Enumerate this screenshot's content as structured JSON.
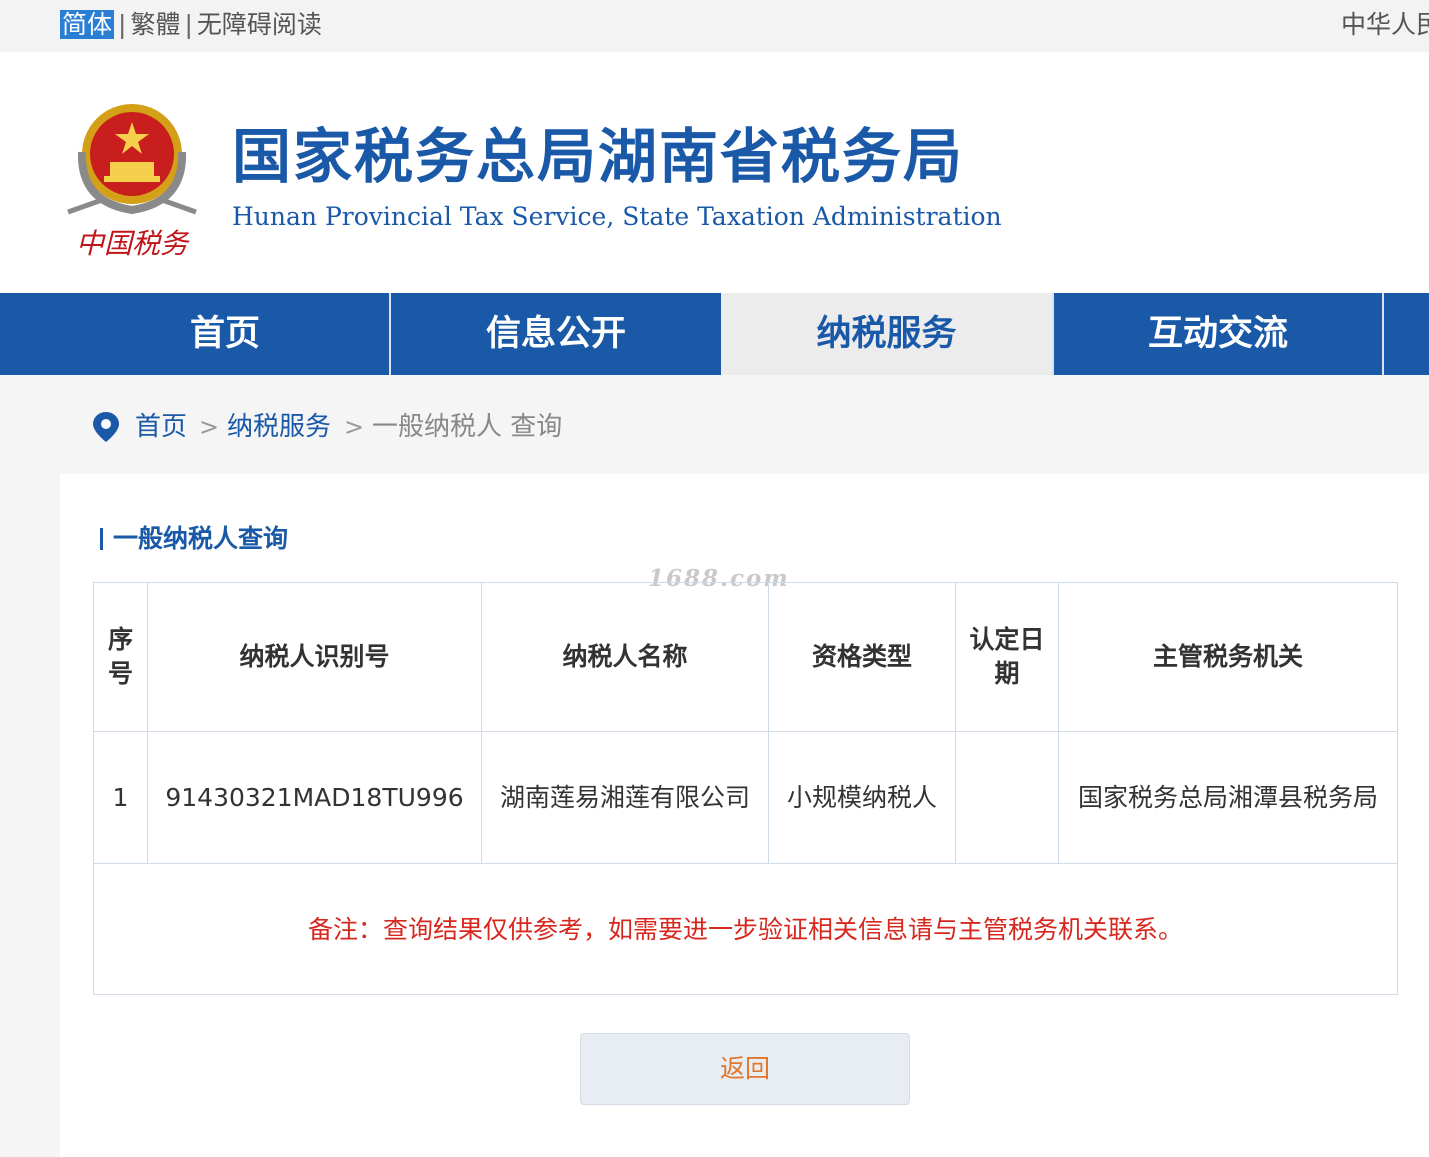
{
  "topbar": {
    "simplified": "简体",
    "traditional": "繁體",
    "accessibility": "无障碍阅读",
    "right_text": "中华人民"
  },
  "header": {
    "title_cn": "国家税务总局湖南省税务局",
    "title_en": "Hunan Provincial  Tax Service,  State Taxation Administration",
    "seal_text": "中国税务"
  },
  "nav": {
    "items": [
      {
        "label": "首页"
      },
      {
        "label": "信息公开"
      },
      {
        "label": "纳税服务",
        "active": true
      },
      {
        "label": "互动交流"
      }
    ]
  },
  "breadcrumb": {
    "home": "首页",
    "section": "纳税服务",
    "current": "一般纳税人 查询"
  },
  "main": {
    "section_title": "一般纳税人查询",
    "watermark": "1688.com",
    "table": {
      "headers": [
        "序号",
        "纳税人识别号",
        "纳税人名称",
        "资格类型",
        "认定日期",
        "主管税务机关"
      ],
      "rows": [
        [
          "1",
          "91430321MAD18TU996",
          "湖南莲易湘莲有限公司",
          "小规模纳税人",
          "",
          "国家税务总局湘潭县税务局"
        ]
      ],
      "note": "备注：查询结果仅供参考，如需要进一步验证相关信息请与主管税务机关联系。"
    },
    "back_label": "返回"
  },
  "colors": {
    "brand_blue": "#1a58a8",
    "note_red": "#d7281f",
    "button_text_orange": "#e0772a",
    "lang_highlight": "#2a7fd4"
  }
}
